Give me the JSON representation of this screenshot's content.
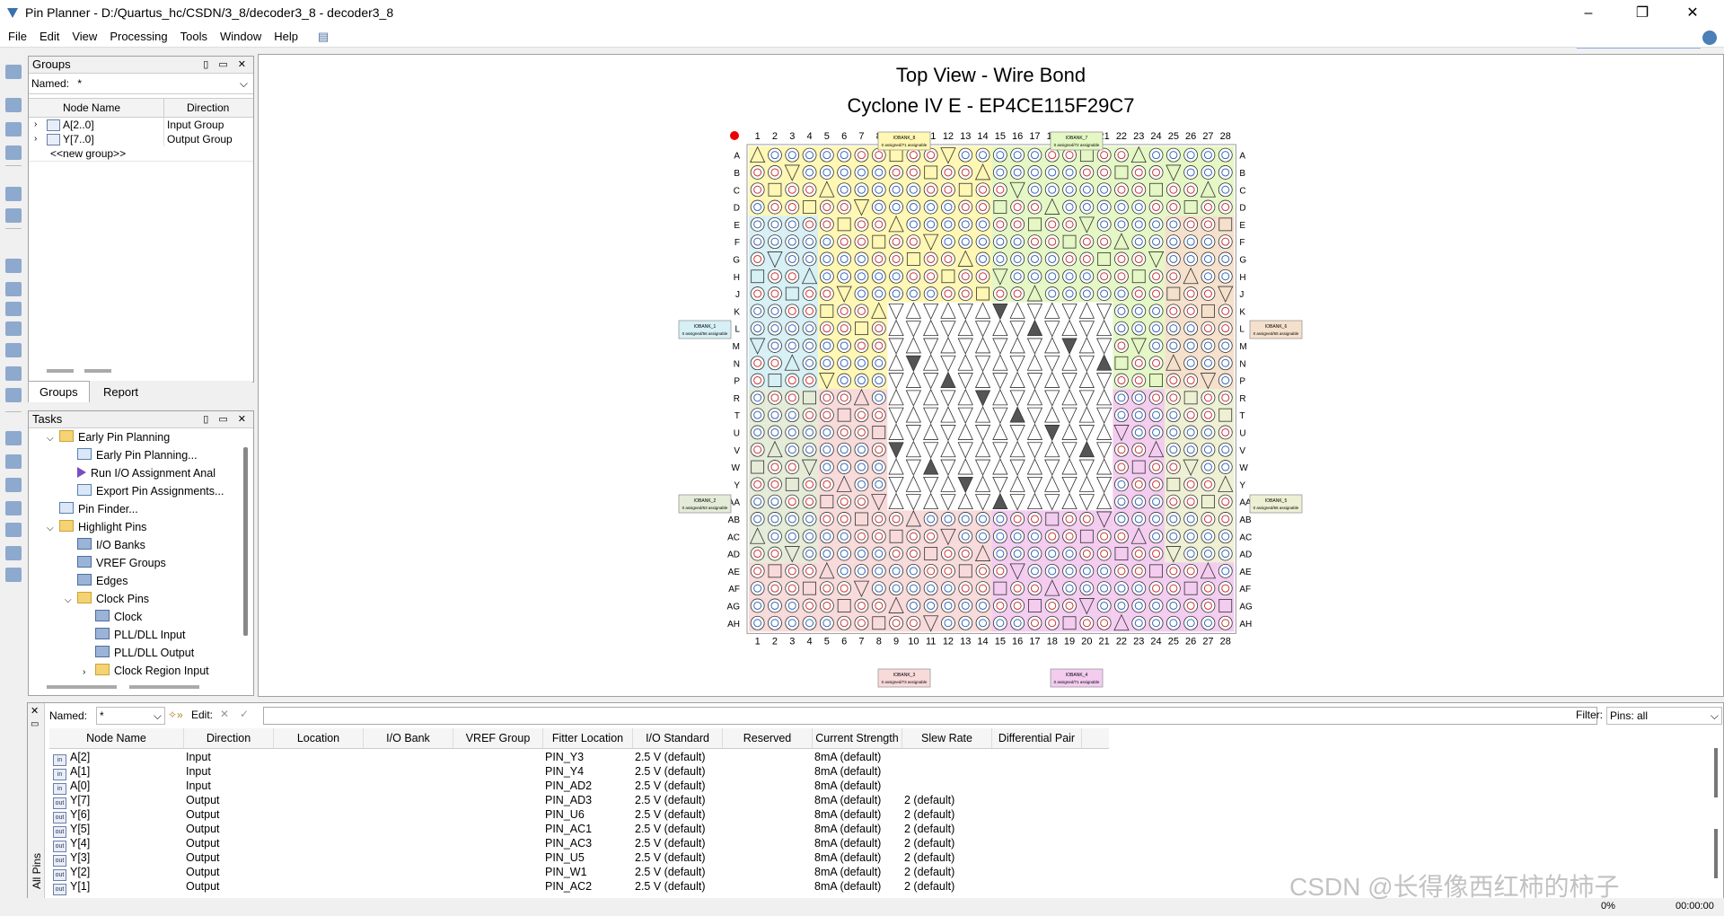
{
  "window": {
    "title": "Pin Planner - D:/Quartus_hc/CSDN/3_8/decoder3_8 - decoder3_8"
  },
  "menu": [
    "File",
    "Edit",
    "View",
    "Processing",
    "Tools",
    "Window",
    "Help"
  ],
  "groups_panel": {
    "title": "Groups",
    "named_label": "Named:",
    "named_value": "*",
    "columns": [
      "Node Name",
      "Direction"
    ],
    "rows": [
      {
        "name": "A[2..0]",
        "direction": "Input Group"
      },
      {
        "name": "Y[7..0]",
        "direction": "Output Group"
      }
    ],
    "new_group": "<<new group>>",
    "tabs": [
      "Groups",
      "Report"
    ]
  },
  "tasks_panel": {
    "title": "Tasks",
    "items": [
      {
        "label": "Early Pin Planning",
        "level": 1,
        "icon": "folder",
        "expand": "v"
      },
      {
        "label": "Early Pin Planning...",
        "level": 2,
        "icon": "win",
        "expand": ""
      },
      {
        "label": "Run I/O Assignment Anal",
        "level": 2,
        "icon": "arrow",
        "expand": ""
      },
      {
        "label": "Export Pin Assignments...",
        "level": 2,
        "icon": "win",
        "expand": ""
      },
      {
        "label": "Pin Finder...",
        "level": 1,
        "icon": "win",
        "expand": ""
      },
      {
        "label": "Highlight Pins",
        "level": 1,
        "icon": "folder",
        "expand": "v"
      },
      {
        "label": "I/O Banks",
        "level": 2,
        "icon": "grid",
        "expand": ""
      },
      {
        "label": "VREF Groups",
        "level": 2,
        "icon": "grid",
        "expand": ""
      },
      {
        "label": "Edges",
        "level": 2,
        "icon": "grid",
        "expand": ""
      },
      {
        "label": "Clock Pins",
        "level": 2,
        "icon": "folder",
        "expand": "v"
      },
      {
        "label": "Clock",
        "level": 3,
        "icon": "grid",
        "expand": ""
      },
      {
        "label": "PLL/DLL Input",
        "level": 3,
        "icon": "grid",
        "expand": ""
      },
      {
        "label": "PLL/DLL Output",
        "level": 3,
        "icon": "grid",
        "expand": ""
      },
      {
        "label": "Clock Region Input",
        "level": 3,
        "icon": "folder",
        "expand": ">"
      }
    ]
  },
  "chip": {
    "title": "Top View - Wire Bond",
    "device": "Cyclone IV E - EP4CE115F29C7",
    "cols": [
      "1",
      "2",
      "3",
      "4",
      "5",
      "6",
      "7",
      "8",
      "9",
      "10",
      "11",
      "12",
      "13",
      "14",
      "15",
      "16",
      "17",
      "18",
      "19",
      "20",
      "21",
      "22",
      "23",
      "24",
      "25",
      "26",
      "27",
      "28"
    ],
    "rows": [
      "A",
      "B",
      "C",
      "D",
      "E",
      "F",
      "G",
      "H",
      "J",
      "K",
      "L",
      "M",
      "N",
      "P",
      "R",
      "T",
      "U",
      "V",
      "W",
      "Y",
      "AA",
      "AB",
      "AC",
      "AD",
      "AE",
      "AF",
      "AG",
      "AH"
    ],
    "banks": [
      {
        "name": "IOBANK_8",
        "info": "0 assigned/71 assignable",
        "color": "#fff7b3"
      },
      {
        "name": "IOBANK_7",
        "info": "0 assigned/72 assignable",
        "color": "#e4f7c4"
      },
      {
        "name": "IOBANK_1",
        "info": "0 assigned/56 assignable",
        "color": "#d6f0f5"
      },
      {
        "name": "IOBANK_6",
        "info": "0 assigned/65 assignable",
        "color": "#f5e0cc"
      },
      {
        "name": "IOBANK_2",
        "info": "0 assigned/63 assignable",
        "color": "#e4ecd8"
      },
      {
        "name": "IOBANK_5",
        "info": "0 assigned/65 assignable",
        "color": "#eef0d4"
      },
      {
        "name": "IOBANK_3",
        "info": "0 assigned/73 assignable",
        "color": "#f8dada"
      },
      {
        "name": "IOBANK_4",
        "info": "0 assigned/71 assignable",
        "color": "#f3ccf0"
      }
    ]
  },
  "all_pins": {
    "side_title": "All Pins",
    "named_label": "Named:",
    "named_value": "*",
    "edit_label": "Edit:",
    "filter_label": "Filter:",
    "filter_value": "Pins: all",
    "columns": [
      "Node Name",
      "Direction",
      "Location",
      "I/O Bank",
      "VREF Group",
      "Fitter Location",
      "I/O Standard",
      "Reserved",
      "Current Strength",
      "Slew Rate",
      "Differential Pair"
    ],
    "rows": [
      {
        "icon": "in",
        "name": "A[2]",
        "direction": "Input",
        "fitter": "PIN_Y3",
        "std": "2.5 V (default)",
        "current": "8mA (default)",
        "slew": ""
      },
      {
        "icon": "in",
        "name": "A[1]",
        "direction": "Input",
        "fitter": "PIN_Y4",
        "std": "2.5 V (default)",
        "current": "8mA (default)",
        "slew": ""
      },
      {
        "icon": "in",
        "name": "A[0]",
        "direction": "Input",
        "fitter": "PIN_AD2",
        "std": "2.5 V (default)",
        "current": "8mA (default)",
        "slew": ""
      },
      {
        "icon": "out",
        "name": "Y[7]",
        "direction": "Output",
        "fitter": "PIN_AD3",
        "std": "2.5 V (default)",
        "current": "8mA (default)",
        "slew": "2 (default)"
      },
      {
        "icon": "out",
        "name": "Y[6]",
        "direction": "Output",
        "fitter": "PIN_U6",
        "std": "2.5 V (default)",
        "current": "8mA (default)",
        "slew": "2 (default)"
      },
      {
        "icon": "out",
        "name": "Y[5]",
        "direction": "Output",
        "fitter": "PIN_AC1",
        "std": "2.5 V (default)",
        "current": "8mA (default)",
        "slew": "2 (default)"
      },
      {
        "icon": "out",
        "name": "Y[4]",
        "direction": "Output",
        "fitter": "PIN_AC3",
        "std": "2.5 V (default)",
        "current": "8mA (default)",
        "slew": "2 (default)"
      },
      {
        "icon": "out",
        "name": "Y[3]",
        "direction": "Output",
        "fitter": "PIN_U5",
        "std": "2.5 V (default)",
        "current": "8mA (default)",
        "slew": "2 (default)"
      },
      {
        "icon": "out",
        "name": "Y[2]",
        "direction": "Output",
        "fitter": "PIN_W1",
        "std": "2.5 V (default)",
        "current": "8mA (default)",
        "slew": "2 (default)"
      },
      {
        "icon": "out",
        "name": "Y[1]",
        "direction": "Output",
        "fitter": "PIN_AC2",
        "std": "2.5 V (default)",
        "current": "8mA (default)",
        "slew": "2 (default)"
      }
    ]
  },
  "status": {
    "progress": "0%",
    "time": "00:00:00"
  },
  "watermark": "CSDN @长得像西红柿的柿子"
}
